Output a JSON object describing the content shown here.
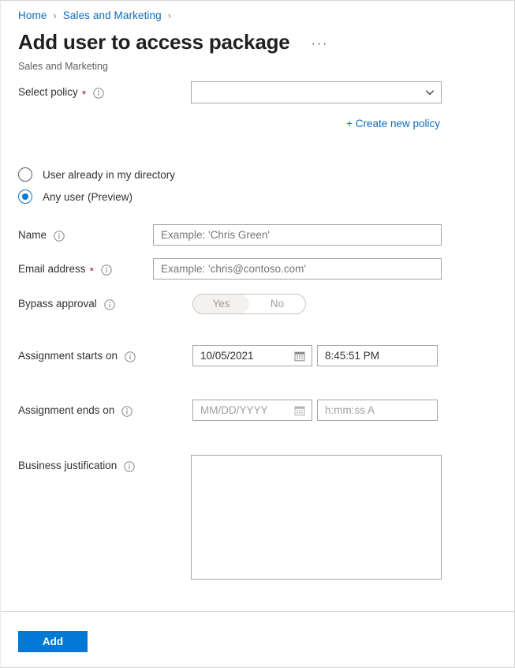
{
  "breadcrumb": {
    "items": [
      {
        "label": "Home"
      },
      {
        "label": "Sales and Marketing"
      }
    ],
    "separator": "›"
  },
  "header": {
    "title": "Add user to access package",
    "subtitle": "Sales and Marketing",
    "more_label": "···"
  },
  "form": {
    "select_policy": {
      "label": "Select policy",
      "required_mark": "*",
      "value": "",
      "placeholder": ""
    },
    "create_new_policy_link": "+ Create new policy",
    "user_type": {
      "options": [
        {
          "label": "User already in my directory",
          "selected": false
        },
        {
          "label": "Any user (Preview)",
          "selected": true
        }
      ]
    },
    "name": {
      "label": "Name",
      "value": "",
      "placeholder": "Example: 'Chris Green'"
    },
    "email_address": {
      "label": "Email address",
      "required_mark": "*",
      "value": "",
      "placeholder": "Example: 'chris@contoso.com'"
    },
    "bypass_approval": {
      "label": "Bypass approval",
      "yes_label": "Yes",
      "no_label": "No",
      "selected": "Yes"
    },
    "assignment_starts_on": {
      "label": "Assignment starts on",
      "date_value": "10/05/2021",
      "date_placeholder": "MM/DD/YYYY",
      "time_value": "8:45:51 PM",
      "time_placeholder": "h:mm:ss A"
    },
    "assignment_ends_on": {
      "label": "Assignment ends on",
      "date_value": "",
      "date_placeholder": "MM/DD/YYYY",
      "time_value": "",
      "time_placeholder": "h:mm:ss A"
    },
    "business_justification": {
      "label": "Business justification",
      "value": ""
    }
  },
  "footer": {
    "add_label": "Add"
  },
  "colors": {
    "accent": "#0078d4",
    "link": "#0f6cbd",
    "required": "#a4262c",
    "border": "#a6a6a6",
    "placeholder": "#a19f9d"
  }
}
